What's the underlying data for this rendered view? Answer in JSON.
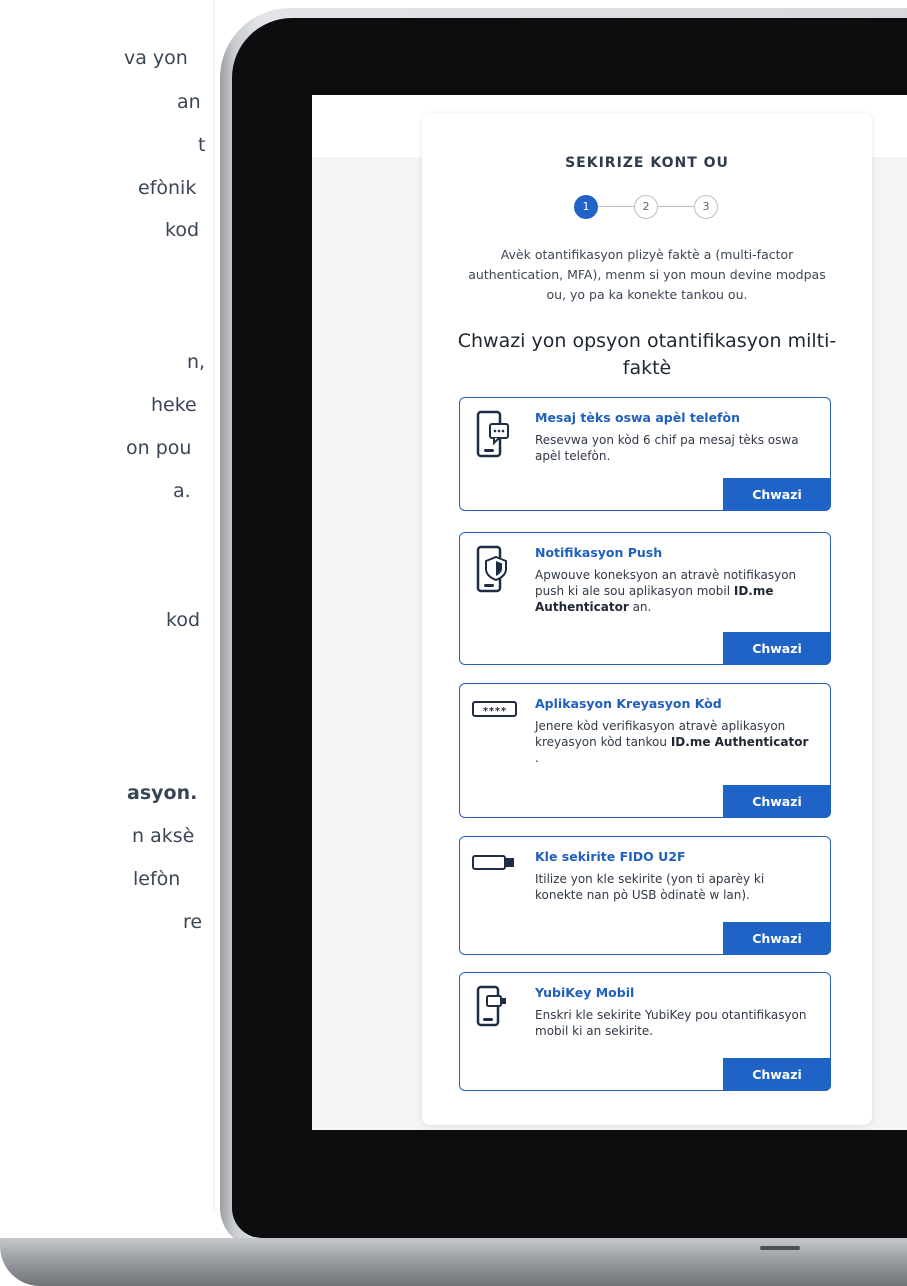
{
  "left_article": {
    "fragments": [
      "va yon",
      "an",
      "t",
      "efònik",
      "kod",
      "n,",
      "heke",
      "on pou",
      "a.",
      "kod",
      "asyon.",
      "n aksè",
      "lefòn",
      "re"
    ]
  },
  "card": {
    "title": "SEKIRIZE KONT OU",
    "steps": [
      "1",
      "2",
      "3"
    ],
    "intro": "Avèk otantifikasyon plizyè faktè a (multi-factor authentication, MFA), menm si yon moun devine modpas ou, yo pa ka konekte tankou ou.",
    "heading": "Chwazi yon opsyon otantifikasyon milti-faktè"
  },
  "options": [
    {
      "title": "Mesaj tèks oswa apèl telefòn",
      "desc": "Resevwa yon kòd 6 chif pa mesaj tèks oswa apèl telefòn.",
      "button": "Chwazi",
      "icon": "phone-message-icon"
    },
    {
      "title": "Notifikasyon Push",
      "desc_before": "Apwouve koneksyon an atravè notifikasyon push ki ale sou aplikasyon mobil ",
      "desc_bold": "ID.me Authenticator",
      "desc_after": " an.",
      "button": "Chwazi",
      "icon": "phone-shield-icon"
    },
    {
      "title": "Aplikasyon Kreyasyon Kòd",
      "desc_before": "Jenere kòd verifikasyon atravè aplikasyon kreyasyon kòd tankou ",
      "desc_bold": "ID.me Authenticator",
      "desc_after": " .",
      "button": "Chwazi",
      "icon": "password-field-icon",
      "icon_text": "****"
    },
    {
      "title": "Kle sekirite FIDO U2F",
      "desc": "Itilize yon kle sekirite (yon ti aparèy ki konekte nan pò USB òdinatè w lan).",
      "button": "Chwazi",
      "icon": "usb-key-icon"
    },
    {
      "title": "YubiKey Mobil",
      "desc": "Enskri kle sekirite YubiKey pou otantifikasyon mobil ki an sekirite.",
      "button": "Chwazi",
      "icon": "phone-usb-key-icon"
    }
  ],
  "colors": {
    "accent": "#1f63c6",
    "title_blue": "#1f5fbd",
    "border": "#2a5fb5"
  }
}
